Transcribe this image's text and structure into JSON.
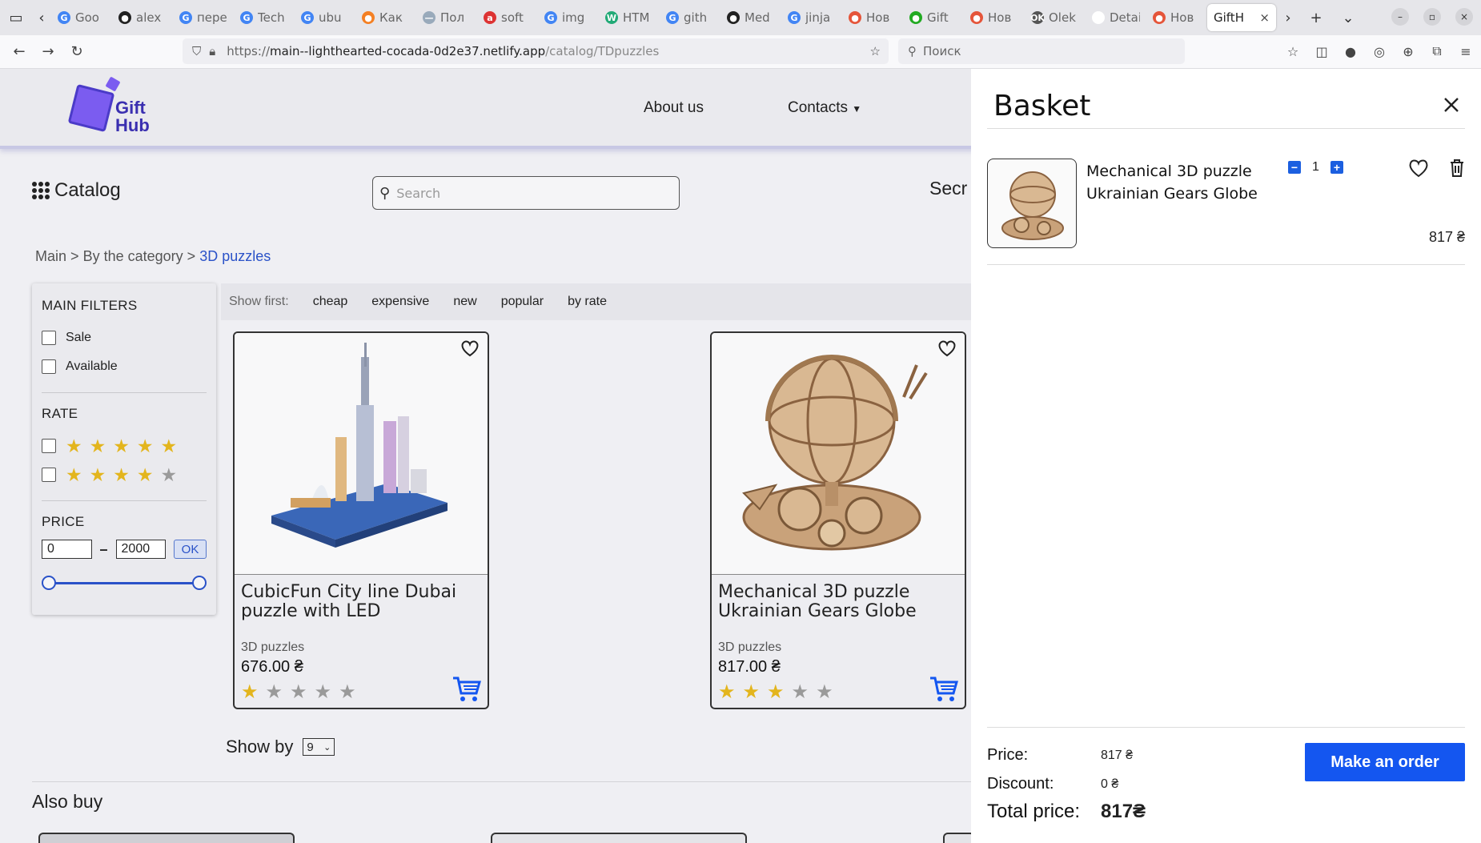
{
  "browser": {
    "tabs": [
      {
        "title": "Goo",
        "color": "#4285f4",
        "glyph": "G"
      },
      {
        "title": "alex",
        "color": "#222222",
        "glyph": "●"
      },
      {
        "title": "пере",
        "color": "#4285f4",
        "glyph": "G"
      },
      {
        "title": "Tech",
        "color": "#4285f4",
        "glyph": "G"
      },
      {
        "title": "ubu",
        "color": "#4285f4",
        "glyph": "G"
      },
      {
        "title": "Как",
        "color": "#f48024",
        "glyph": "●"
      },
      {
        "title": "Пол",
        "color": "#9ab",
        "glyph": "—"
      },
      {
        "title": "soft",
        "color": "#d33",
        "glyph": "a"
      },
      {
        "title": "img",
        "color": "#4285f4",
        "glyph": "G"
      },
      {
        "title": "HTM",
        "color": "#2a7",
        "glyph": "W"
      },
      {
        "title": "gith",
        "color": "#4285f4",
        "glyph": "G"
      },
      {
        "title": "Med",
        "color": "#222222",
        "glyph": "●"
      },
      {
        "title": "jinja",
        "color": "#4285f4",
        "glyph": "G"
      },
      {
        "title": "Нов",
        "color": "#e5553a",
        "glyph": "●"
      },
      {
        "title": "Gift",
        "color": "#2a2",
        "glyph": "●"
      },
      {
        "title": "Нов",
        "color": "#e5553a",
        "glyph": "●"
      },
      {
        "title": "Olek",
        "color": "#555",
        "glyph": "OK"
      },
      {
        "title": "Detail S",
        "color": "#ffffff",
        "glyph": ""
      },
      {
        "title": "Нов",
        "color": "#e5553a",
        "glyph": "●"
      }
    ],
    "active_tab": "GiftH",
    "url_prefix": "https://",
    "url_host": "main--lighthearted-cocada-0d2e37.netlify.app",
    "url_path": "/catalog/TDpuzzles",
    "search_placeholder": "Поиск"
  },
  "header": {
    "logo_line1": "Gift",
    "logo_line2": "Hub",
    "nav_about": "About us",
    "nav_contacts": "Contacts"
  },
  "catalog_label": "Catalog",
  "search_placeholder": "Search",
  "secret_link": "Secr",
  "breadcrumb": {
    "main": "Main",
    "sep": ">",
    "category": "By the category",
    "current": "3D puzzles"
  },
  "filters": {
    "main_title": "MAIN FILTERS",
    "sale": "Sale",
    "available": "Available",
    "rate_title": "RATE",
    "rate_options": [
      5,
      4
    ],
    "price_title": "PRICE",
    "price_min": "0",
    "price_max": "2000",
    "price_dash": "–",
    "ok": "OK"
  },
  "sort": {
    "label": "Show first:",
    "options": [
      "cheap",
      "expensive",
      "new",
      "popular",
      "by rate"
    ]
  },
  "products": [
    {
      "name": "CubicFun City line Dubai puzzle with LED",
      "category": "3D puzzles",
      "price": "676.00 ₴",
      "rating": 1
    },
    {
      "name": "Mechanical 3D puzzle Ukrainian Gears Globe",
      "category": "3D puzzles",
      "price": "817.00 ₴",
      "rating": 3
    }
  ],
  "show_by": {
    "label": "Show by",
    "value": "9"
  },
  "also_buy": "Also buy",
  "basket": {
    "title": "Basket",
    "item": {
      "name": "Mechanical 3D puzzle Ukrainian Gears Globe",
      "qty": "1",
      "price": "817 ₴"
    },
    "price_label": "Price:",
    "price_value": "817 ₴",
    "discount_label": "Discount:",
    "discount_value": "0 ₴",
    "total_label": "Total price:",
    "total_value": "817₴",
    "order_button": "Make an order"
  },
  "colors": {
    "accent": "#1456f0",
    "star": "#e3b51d",
    "brand": "#7b5cf0"
  }
}
